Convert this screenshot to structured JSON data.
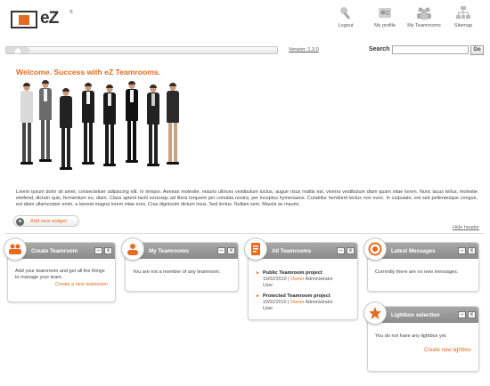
{
  "logo": {
    "text": "eZ",
    "mark": "®"
  },
  "nav": [
    {
      "label": "Logout",
      "icon": "logout-icon"
    },
    {
      "label": "My profile",
      "icon": "profile-icon"
    },
    {
      "label": "My Teamrooms",
      "icon": "teamrooms-icon"
    },
    {
      "label": "Sitemap",
      "icon": "sitemap-icon"
    }
  ],
  "toolbar": {
    "version": "Version: 1.3.0",
    "search_label": "Search",
    "search_value": "",
    "go": "Go"
  },
  "hero": {
    "welcome": "Welcome. Success with eZ Teamrooms.",
    "text": "Lorem ipsum dolor sit amet, consectetuer adipiscing elit. In tempor. Aenean molestie, mauris ultrices vestibulum luctus, augue risus mattis est, viverra vestibulum diam quam vitae lorem. Nunc lacus tellus, molestie eleifend, dictum quis, fermentum eu, diam. Class aptent taciti sociosqu ad litora torquent per conubia nostra, per inceptos hymenaeos. Curabitur hendrerit lectus non nunc. In vulputate, est sed pellentesque congue, est diam ullamcorper enim, a laoreet magna lorem vitae eros. Cras dignissim dictum risus. Sed lectus. Nullam sem. Mauris ac mauris.",
    "add_widget": "Add new widget",
    "hide_header": "Hide header"
  },
  "widgets": {
    "create": {
      "title": "Create Teamroom",
      "text": "Add your teamroom and get all the things to manage your team.",
      "link": "Create a new teamroom"
    },
    "my_teamrooms": {
      "title": "My Teamrooms",
      "text": "You are not a member of any teamroom."
    },
    "all_teamrooms": {
      "title": "All Teamrooms",
      "projects": [
        {
          "title": "Public Teamroom project",
          "date": "16/02/2010",
          "owner_label": "Owner",
          "owner": "Administrator",
          "role": "User"
        },
        {
          "title": "Protected Teamroom project",
          "date": "16/02/2010",
          "owner_label": "Owner",
          "owner": "Administrator",
          "role": "User"
        }
      ]
    },
    "latest_messages": {
      "title": "Latest Messages",
      "text": "Currently there are no new messages."
    },
    "lightbox": {
      "title": "Lightbox selection",
      "text": "You do not have any lightbox yet.",
      "link": "Create new lightbox"
    },
    "btn_min": "–",
    "btn_close": "x"
  }
}
